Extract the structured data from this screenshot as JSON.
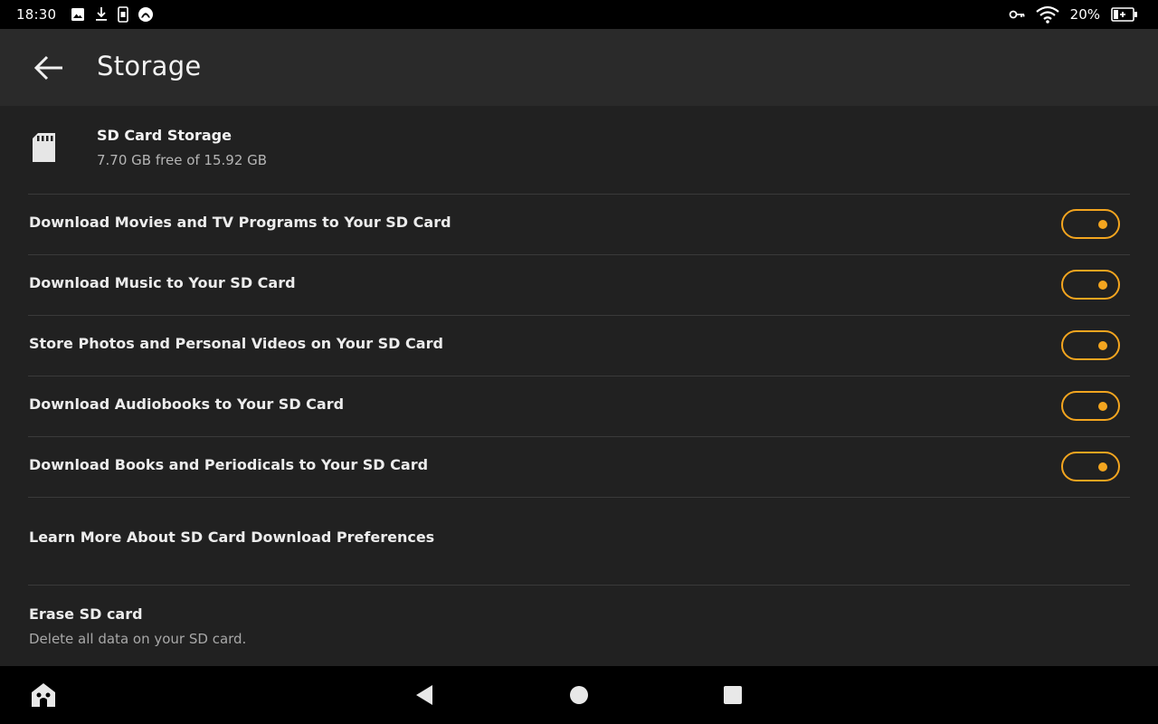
{
  "status_bar": {
    "time": "18:30",
    "notification_icons": [
      "image-icon",
      "download-icon",
      "phone-icon",
      "alexa-icon"
    ],
    "status_icons": [
      "vpn-key-icon",
      "wifi-icon",
      "battery-charging-icon"
    ],
    "battery_text": "20%"
  },
  "app_bar": {
    "title": "Storage",
    "back_icon": "arrow-back-icon"
  },
  "sd_card": {
    "icon": "sd-card-icon",
    "title": "SD Card Storage",
    "subtitle": "7.70 GB free of 15.92 GB"
  },
  "toggles": [
    {
      "label": "Download Movies and TV Programs to Your SD Card",
      "on": true
    },
    {
      "label": "Download Music to Your SD Card",
      "on": true
    },
    {
      "label": "Store Photos and Personal Videos on Your SD Card",
      "on": true
    },
    {
      "label": "Download Audiobooks to Your SD Card",
      "on": true
    },
    {
      "label": "Download Books and Periodicals to Your SD Card",
      "on": true
    }
  ],
  "learn_more": {
    "label": "Learn More About SD Card Download Preferences"
  },
  "erase": {
    "title": "Erase SD card",
    "subtitle": "Delete all data on your SD card."
  },
  "nav_bar": {
    "icons": [
      "home-icon",
      "back-triangle-icon",
      "home-circle-icon",
      "recents-square-icon"
    ]
  },
  "colors": {
    "accent": "#f3a51f",
    "background": "#212121",
    "app_bar": "#2a2a2a",
    "system_bars": "#000000",
    "divider": "#3a3a3a"
  }
}
